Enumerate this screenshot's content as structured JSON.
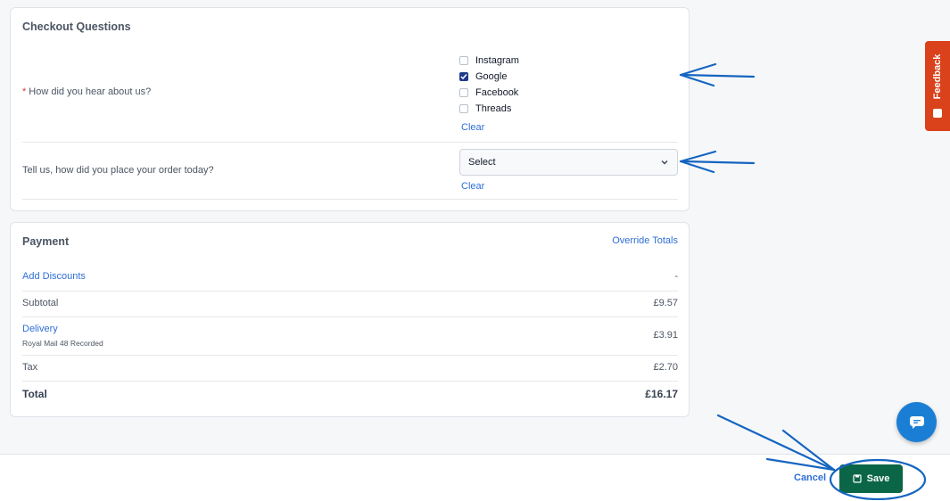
{
  "checkout": {
    "title": "Checkout Questions",
    "q1": {
      "required_mark": "*",
      "label": "How did you hear about us?",
      "options": [
        {
          "label": "Instagram",
          "checked": false
        },
        {
          "label": "Google",
          "checked": true
        },
        {
          "label": "Facebook",
          "checked": false
        },
        {
          "label": "Threads",
          "checked": false
        }
      ],
      "clear": "Clear"
    },
    "q2": {
      "label": "Tell us, how did you place your order today?",
      "select_value": "Select",
      "clear": "Clear"
    }
  },
  "payment": {
    "title": "Payment",
    "override": "Override Totals",
    "discounts": {
      "label": "Add Discounts",
      "value": "-"
    },
    "subtotal": {
      "label": "Subtotal",
      "value": "£9.57"
    },
    "delivery": {
      "label": "Delivery",
      "method": "Royal Mail 48 Recorded",
      "value": "£3.91"
    },
    "tax": {
      "label": "Tax",
      "value": "£2.70"
    },
    "total": {
      "label": "Total",
      "value": "£16.17"
    }
  },
  "footer": {
    "cancel": "Cancel",
    "save": "Save"
  },
  "feedback": {
    "label": "Feedback"
  },
  "colors": {
    "accent": "#2f6fd6",
    "save": "#0b6647",
    "feedback": "#d9421b",
    "chat": "#1a7fd4",
    "annotation": "#1565c0"
  }
}
